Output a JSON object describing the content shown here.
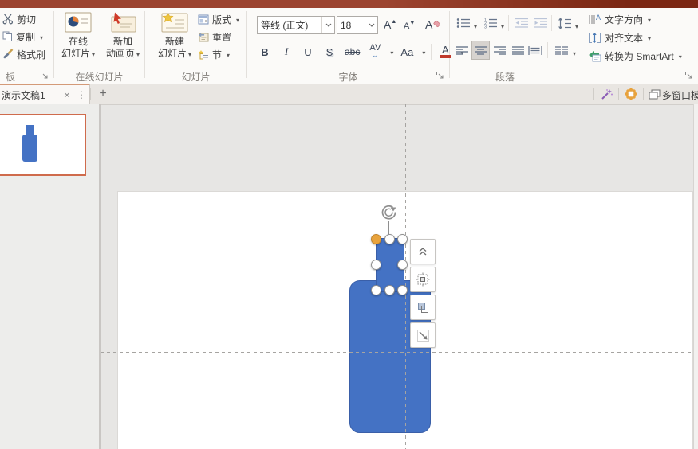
{
  "colors": {
    "accent_blue": "#4472c4",
    "accent_blue_border": "#3a5fa8",
    "titlebar_red": "#9c4430",
    "titlebar_red_dark": "#7b2713",
    "thumb_border": "#cf6b4c",
    "handle_orange": "#e8a33d",
    "font_color_red": "#c0392b"
  },
  "ribbon": {
    "clipboard": {
      "cut": "剪切",
      "copy": "复制",
      "format_painter": "格式刷",
      "group_label": "板"
    },
    "online_slides": {
      "online_line1": "在线",
      "online_line2": "幻灯片",
      "anim_line1": "新加",
      "anim_line2": "动画页",
      "group_label": "在线幻灯片"
    },
    "slides": {
      "new_line1": "新建",
      "new_line2": "幻灯片",
      "layout": "版式",
      "reset": "重置",
      "section": "节",
      "group_label": "幻灯片"
    },
    "font": {
      "name": "等线 (正文)",
      "size": "18",
      "grow": "A",
      "shrink": "A",
      "clear": "A",
      "bold": "B",
      "italic": "I",
      "underline": "U",
      "shadow": "S",
      "strikethrough": "abc",
      "char_spacing": "AV",
      "change_case": "Aa",
      "font_color": "A",
      "group_label": "字体"
    },
    "paragraph": {
      "text_direction": "文字方向",
      "align_text": "对齐文本",
      "smartart": "转换为 SmartArt",
      "group_label": "段落"
    }
  },
  "tabbar": {
    "document_tab": "演示文稿1",
    "close": "×",
    "more": "⋮",
    "new_tab": "+",
    "multi_window": "多窗口模"
  }
}
